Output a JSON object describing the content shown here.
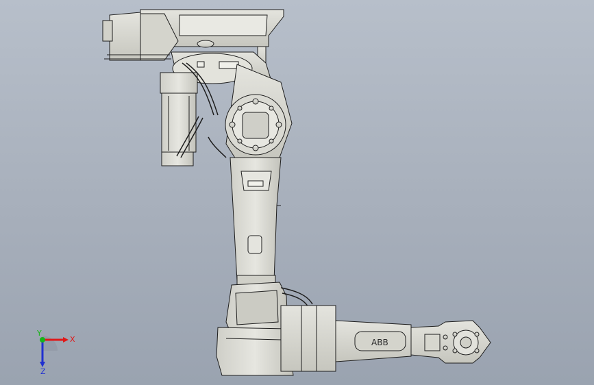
{
  "viewport": {
    "background_top": "#b7bfca",
    "background_bottom": "#9aa3b0",
    "model_fill": "#dcdcd6",
    "model_shadow": "#bdbdb5",
    "model_edge": "#1e1e1e"
  },
  "model": {
    "arm_brand_text": "ABB"
  },
  "triad": {
    "x_label": "X",
    "y_label": "Y",
    "z_label": "Z",
    "x_color": "#e01818",
    "y_color": "#18b418",
    "z_color": "#2030d0"
  }
}
